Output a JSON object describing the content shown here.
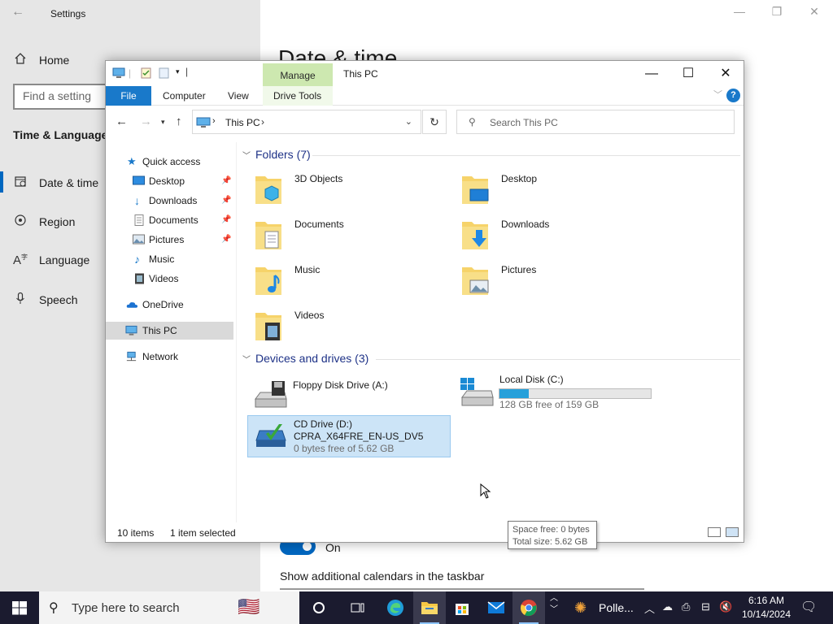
{
  "settings": {
    "app_title": "Settings",
    "nav": [
      {
        "label": "Home",
        "icon": "home-icon"
      },
      {
        "label": "Date & time",
        "icon": "date-time-icon"
      },
      {
        "label": "Region",
        "icon": "region-icon"
      },
      {
        "label": "Language",
        "icon": "language-icon"
      },
      {
        "label": "Speech",
        "icon": "microphone-icon"
      }
    ],
    "search_placeholder": "Find a setting",
    "section_title": "Time & Language",
    "page_title": "Date & time",
    "toggle_label": "On",
    "calendars_label": "Show additional calendars in the taskbar",
    "accent_color": "#0067c0"
  },
  "explorer": {
    "title": "This PC",
    "manage_tab": "Manage",
    "ribbon_tabs": [
      "File",
      "Computer",
      "View",
      "Drive Tools"
    ],
    "address": {
      "path": "This PC",
      "separator": "›"
    },
    "search_placeholder": "Search This PC",
    "nav_pane": {
      "quick_access": "Quick access",
      "pinned": [
        {
          "label": "Desktop",
          "pinned": true
        },
        {
          "label": "Downloads",
          "pinned": true
        },
        {
          "label": "Documents",
          "pinned": true
        },
        {
          "label": "Pictures",
          "pinned": true
        },
        {
          "label": "Music",
          "pinned": false
        },
        {
          "label": "Videos",
          "pinned": false
        }
      ],
      "onedrive": "OneDrive",
      "this_pc": "This PC",
      "network": "Network"
    },
    "folders_header": "Folders (7)",
    "folders": [
      "3D Objects",
      "Desktop",
      "Documents",
      "Downloads",
      "Music",
      "Pictures",
      "Videos"
    ],
    "devices_header": "Devices and drives (3)",
    "drives": {
      "floppy": {
        "name": "Floppy Disk Drive (A:)"
      },
      "local": {
        "name": "Local Disk (C:)",
        "free_text": "128 GB free of 159 GB",
        "used_fraction": 0.195
      },
      "cd": {
        "name": "CD Drive (D:)",
        "label": "CPRA_X64FRE_EN-US_DV5",
        "free_text": "0 bytes free of 5.62 GB"
      }
    },
    "tooltip": {
      "line1": "Space free: 0 bytes",
      "line2": "Total size: 5.62 GB"
    },
    "status": {
      "items": "10 items",
      "selected": "1 item selected"
    }
  },
  "taskbar": {
    "search_placeholder": "Type here to search",
    "app_label": "Polle...",
    "time": "6:16 AM",
    "date": "10/14/2024"
  }
}
